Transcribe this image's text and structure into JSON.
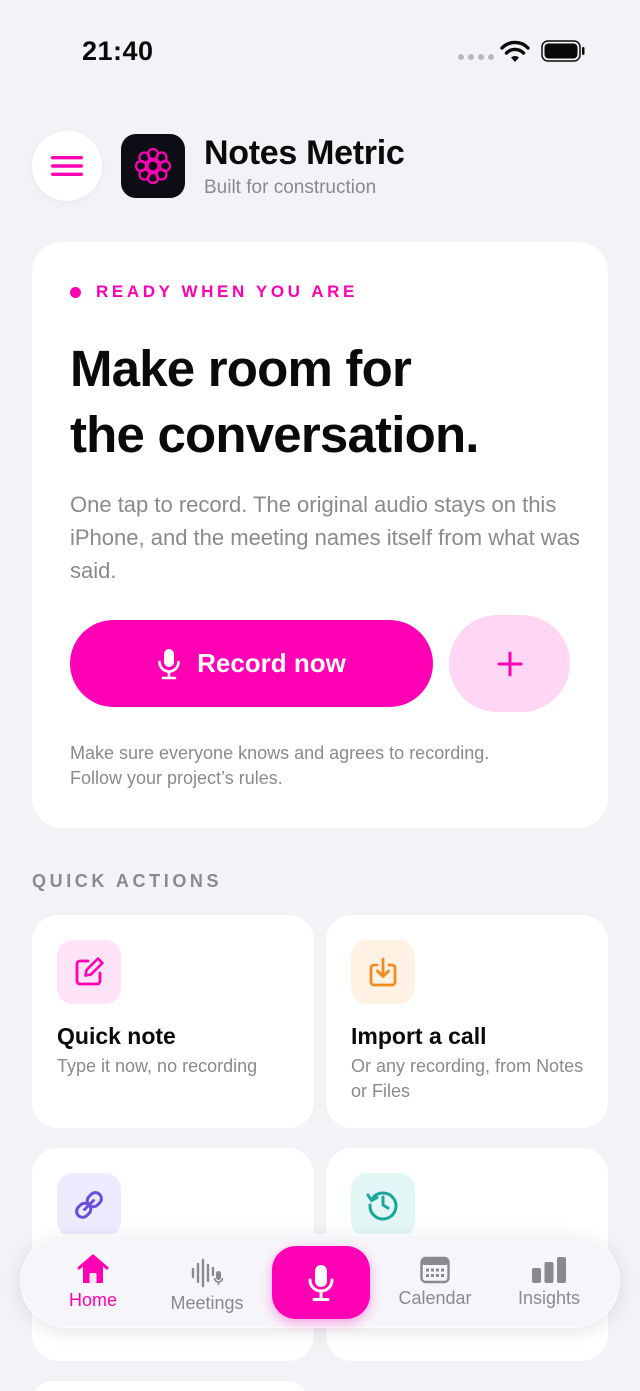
{
  "status": {
    "time": "21:40"
  },
  "header": {
    "title": "Notes Metric",
    "subtitle": "Built for construction"
  },
  "hero": {
    "eyebrow": "READY WHEN YOU ARE",
    "title_line1": "Make room for",
    "title_line2": "the conversation.",
    "body": "One tap to record. The original audio stays on this iPhone, and the meeting names itself from what was said.",
    "record_label": "Record now",
    "consent_line1": "Make sure everyone knows and agrees to recording.",
    "consent_line2": "Follow your project’s rules."
  },
  "quick_actions": {
    "label": "QUICK ACTIONS",
    "cards": [
      {
        "title": "Quick note",
        "desc": "Type it now, no recording",
        "icon": "edit-icon",
        "accent": "#ff00b4",
        "bg": "#ffe3f6"
      },
      {
        "title": "Import a call",
        "desc": "Or any recording, from Notes or Files",
        "icon": "import-icon",
        "accent": "#f28a1e",
        "bg": "#fff1e4"
      },
      {
        "title": "",
        "desc": "",
        "icon": "link-icon",
        "accent": "#6a4ee0",
        "bg": "#ecebff"
      },
      {
        "title": "",
        "desc": "",
        "icon": "history-icon",
        "accent": "#1aa79a",
        "bg": "#e2f7f5"
      }
    ]
  },
  "tabbar": {
    "items": [
      {
        "label": "Home",
        "icon": "home-icon",
        "active": true
      },
      {
        "label": "Meetings",
        "icon": "waveform-icon",
        "active": false
      },
      {
        "label": "",
        "icon": "microphone-icon",
        "active": false
      },
      {
        "label": "Calendar",
        "icon": "calendar-icon",
        "active": false
      },
      {
        "label": "Insights",
        "icon": "bar-chart-icon",
        "active": false
      }
    ]
  },
  "colors": {
    "accent": "#ff00b4",
    "accent_soft": "#ffd6f3",
    "background": "#f2f2f7",
    "muted_text": "#8a8a8e"
  }
}
